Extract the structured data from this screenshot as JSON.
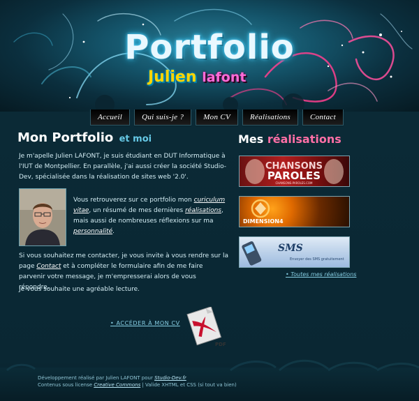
{
  "header": {
    "title": "Portfolio",
    "subtitle_first": "Julien",
    "subtitle_last": "lafont"
  },
  "nav": {
    "items": [
      "Accueil",
      "Qui suis-je ?",
      "Mon CV",
      "Réalisations",
      "Contact"
    ]
  },
  "main": {
    "heading": "Mon Portfolio",
    "heading_light": "et moi",
    "p1": "Je m'apelle Julien LAFONT, je suis étudiant en DUT Informatique à l'IUT de Montpellier. En parallèle, j'ai aussi créer la société Studio-Dev, spécialisée dans la réalisation de sites web '2.0'.",
    "p2": {
      "t1": "Vous retrouverez sur ce portfolio mon ",
      "link1": "curiculum vitae",
      "t2": ", un résumé de mes dernières ",
      "link2": "réalisations",
      "t3": ", mais aussi de nombreuses réflexions sur ma ",
      "link3": "personnalité",
      "t4": "."
    },
    "p3": {
      "t1": "Si vous souhaitez me contacter, je vous invite à vous rendre sur la page ",
      "link": "Contact",
      "t2": " et à compléter le formulaire afin de me faire parvenir votre message, je m'empresserai alors de vous répondre."
    },
    "p4": "Je vous souhaite une agréable lecture.",
    "cv_link": "• ACCÉDER À MON CV",
    "pdf_label": "PDF"
  },
  "side": {
    "heading": "Mes",
    "heading_accent": "réalisations",
    "banners": [
      {
        "text1": "CHANSONS",
        "text2": "PAROLES",
        "small": "CHANSONS-PAROLES.COM"
      },
      {
        "text1": "DIMENSION4"
      },
      {
        "text1": "SMS",
        "small": "Envoyer des SMS gratuitement"
      }
    ],
    "all_link": "• Toutes mes réalisations"
  },
  "footer": {
    "line1_text": "Développement réalisé par Julien LAFONT pour ",
    "line1_link": "Studio-Dev.fr",
    "line2_text1": "Contenus sous license ",
    "line2_link": "Creative Commons",
    "line2_text2": " | Valide XHTML et CSS (si tout va bien)"
  },
  "colors": {
    "accent_pink": "#ff6fa6",
    "accent_cyan": "#66c9e6",
    "background": "#0c2a36"
  }
}
